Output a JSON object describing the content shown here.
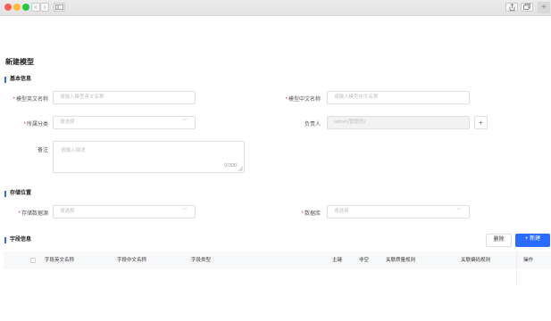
{
  "toolbar": {
    "nav_back_glyph": "‹",
    "nav_forward_glyph": "›"
  },
  "page": {
    "title": "新建模型"
  },
  "basic": {
    "section_title": "基本信息",
    "en_name_label": "模型英文名称",
    "en_name_placeholder": "请输入模型英文名称",
    "cn_name_label": "模型中文名称",
    "cn_name_placeholder": "请输入模型中文名称",
    "category_label": "所属分类",
    "category_placeholder": "请选择",
    "owner_label": "负责人",
    "owner_value": "admin(管理员)",
    "owner_add": "+",
    "remark_label": "备注",
    "remark_placeholder": "请输入描述",
    "remark_count": "0/300"
  },
  "storage": {
    "section_title": "存储位置",
    "datasource_label": "存储数据源",
    "datasource_placeholder": "请选择",
    "database_label": "数据库",
    "database_placeholder": "请选择"
  },
  "fields": {
    "section_title": "字段信息",
    "delete_label": "删除",
    "new_label": "新建",
    "new_icon": "+",
    "columns": [
      "字段英文名称",
      "字段中文名称",
      "字段类型",
      "主键",
      "非空",
      "关联质量规则",
      "关联编码规则",
      "操作"
    ]
  },
  "colors": {
    "accent": "#2b6bff",
    "required": "#f5222d",
    "close_dot": "#fe5f57",
    "min_dot": "#febc2e",
    "max_dot": "#28c840"
  }
}
